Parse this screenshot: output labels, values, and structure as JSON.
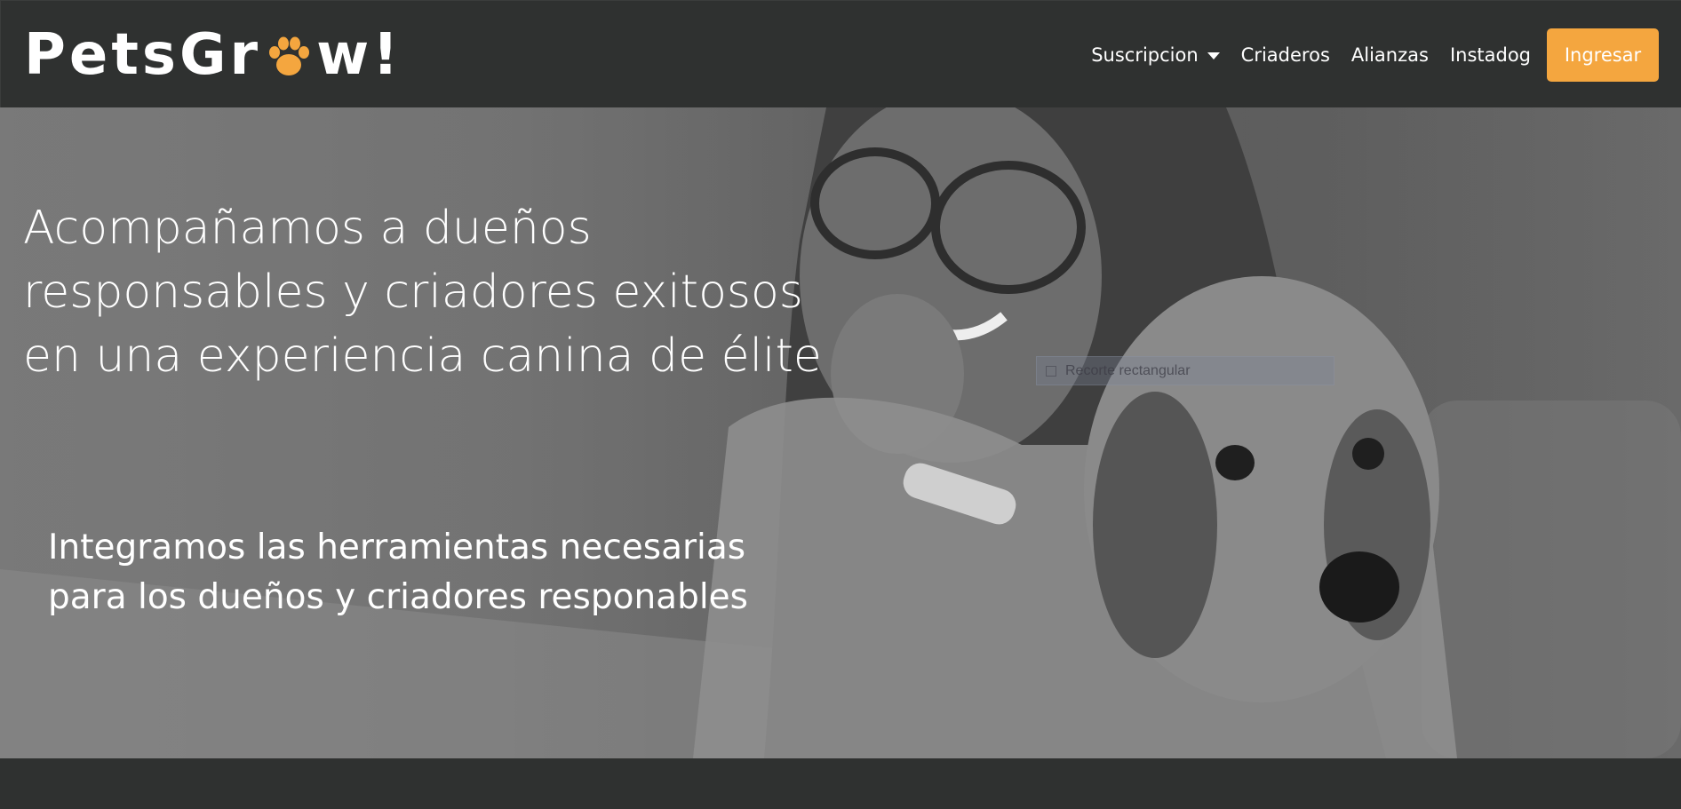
{
  "brand": {
    "logo_before": "PetsGr",
    "logo_after": "w!",
    "accent_color": "#f4a63f"
  },
  "nav": {
    "items": [
      {
        "label": "Suscripcion",
        "has_dropdown": true
      },
      {
        "label": "Criaderos"
      },
      {
        "label": "Alianzas"
      },
      {
        "label": "Instadog"
      }
    ],
    "login_label": "Ingresar"
  },
  "hero": {
    "title_lines": [
      "Acompañamos a dueños",
      "responsables y criadores exitosos",
      "en una experiencia canina de élite"
    ],
    "subtitle_lines": [
      "Integramos las herramientas necesarias",
      "para los dueños y criadores responables"
    ]
  },
  "overlay_tooltip": {
    "label": "Recorte rectangular"
  }
}
